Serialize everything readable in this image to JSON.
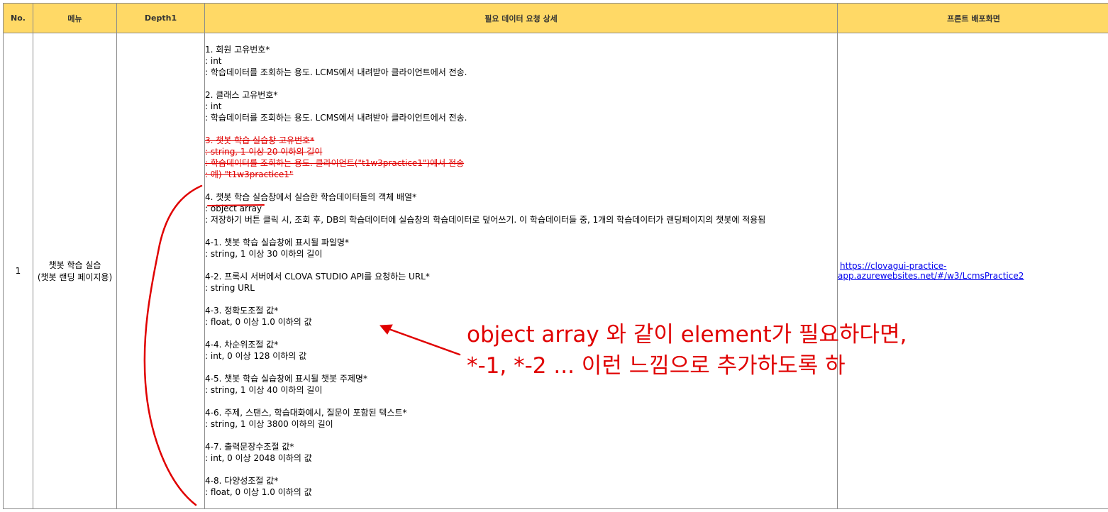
{
  "headers": {
    "no": "No.",
    "menu": "메뉴",
    "depth1": "Depth1",
    "detail": "필요 데이터 요청 상세",
    "front": "프론트 배포화면"
  },
  "row": {
    "no": "1",
    "menu_line1": "챗봇 학습 실습",
    "menu_line2": "(챗봇 랜딩 페이지용)",
    "depth1": "",
    "link": "https://clovagui-practice-app.azurewebsites.net/#/w3/LcmsPractice2"
  },
  "detail": {
    "item1": {
      "title": "1. 회원 고유번호*",
      "type": ": int",
      "desc": ": 학습데이터를 조회하는 용도. LCMS에서 내려받아 클라이언트에서 전송."
    },
    "item2": {
      "title": "2. 클래스 고유번호*",
      "type": ": int",
      "desc": ": 학습데이터를 조회하는 용도. LCMS에서 내려받아 클라이언트에서 전송."
    },
    "item3": {
      "title": "3. 챗봇 학습 실습창 고유번호*",
      "type": ": string, 1 이상 20 이하의 길이",
      "desc": ": 학습데이터를 조회하는 용도. 클라이언트(\"t1w3practice1\")에서 전송",
      "example": ": 예) \"t1w3practice1\""
    },
    "item4": {
      "title": "4. 챗봇 학습 실습창에서 실습한 학습데이터들의 객체 배열*",
      "type": ": object array",
      "desc": ": 저장하기 버튼 클릭 시, 조회 후, DB의 학습데이터에 실습창의 학습데이터로 덮어쓰기. 이 학습데이터들 중, 1개의 학습데이터가 랜딩페이지의 챗봇에 적용됨"
    },
    "sub": [
      {
        "title": "4-1. 챗봇 학습 실습창에 표시될 파일명*",
        "type": ": string, 1 이상 30 이하의 길이"
      },
      {
        "title": "4-2. 프록시 서버에서 CLOVA STUDIO API를 요청하는 URL*",
        "type": ": string URL"
      },
      {
        "title": "4-3. 정확도조절 값*",
        "type": ": float, 0 이상 1.0 이하의 값"
      },
      {
        "title": "4-4. 차순위조절 값*",
        "type": ": int, 0 이상 128 이하의 값"
      },
      {
        "title": "4-5. 챗봇 학습 실습창에 표시될 챗봇 주제명*",
        "type": ": string, 1 이상 40 이하의 길이"
      },
      {
        "title": "4-6. 주제, 스탠스, 학습대화예시, 질문이 포함된 텍스트*",
        "type": ": string, 1 이상 3800 이하의 길이"
      },
      {
        "title": "4-7. 출력문장수조절 값*",
        "type": ": int, 0 이상 2048 이하의 값"
      },
      {
        "title": "4-8. 다양성조절 값*",
        "type": ": float, 0 이상 1.0 이하의 값"
      }
    ]
  },
  "annotation": {
    "line1": "object array 와 같이 element가 필요하다면,",
    "line2": "*-1, *-2 ... 이런 느낌으로 추가하도록 하",
    "color": "#e00000"
  }
}
